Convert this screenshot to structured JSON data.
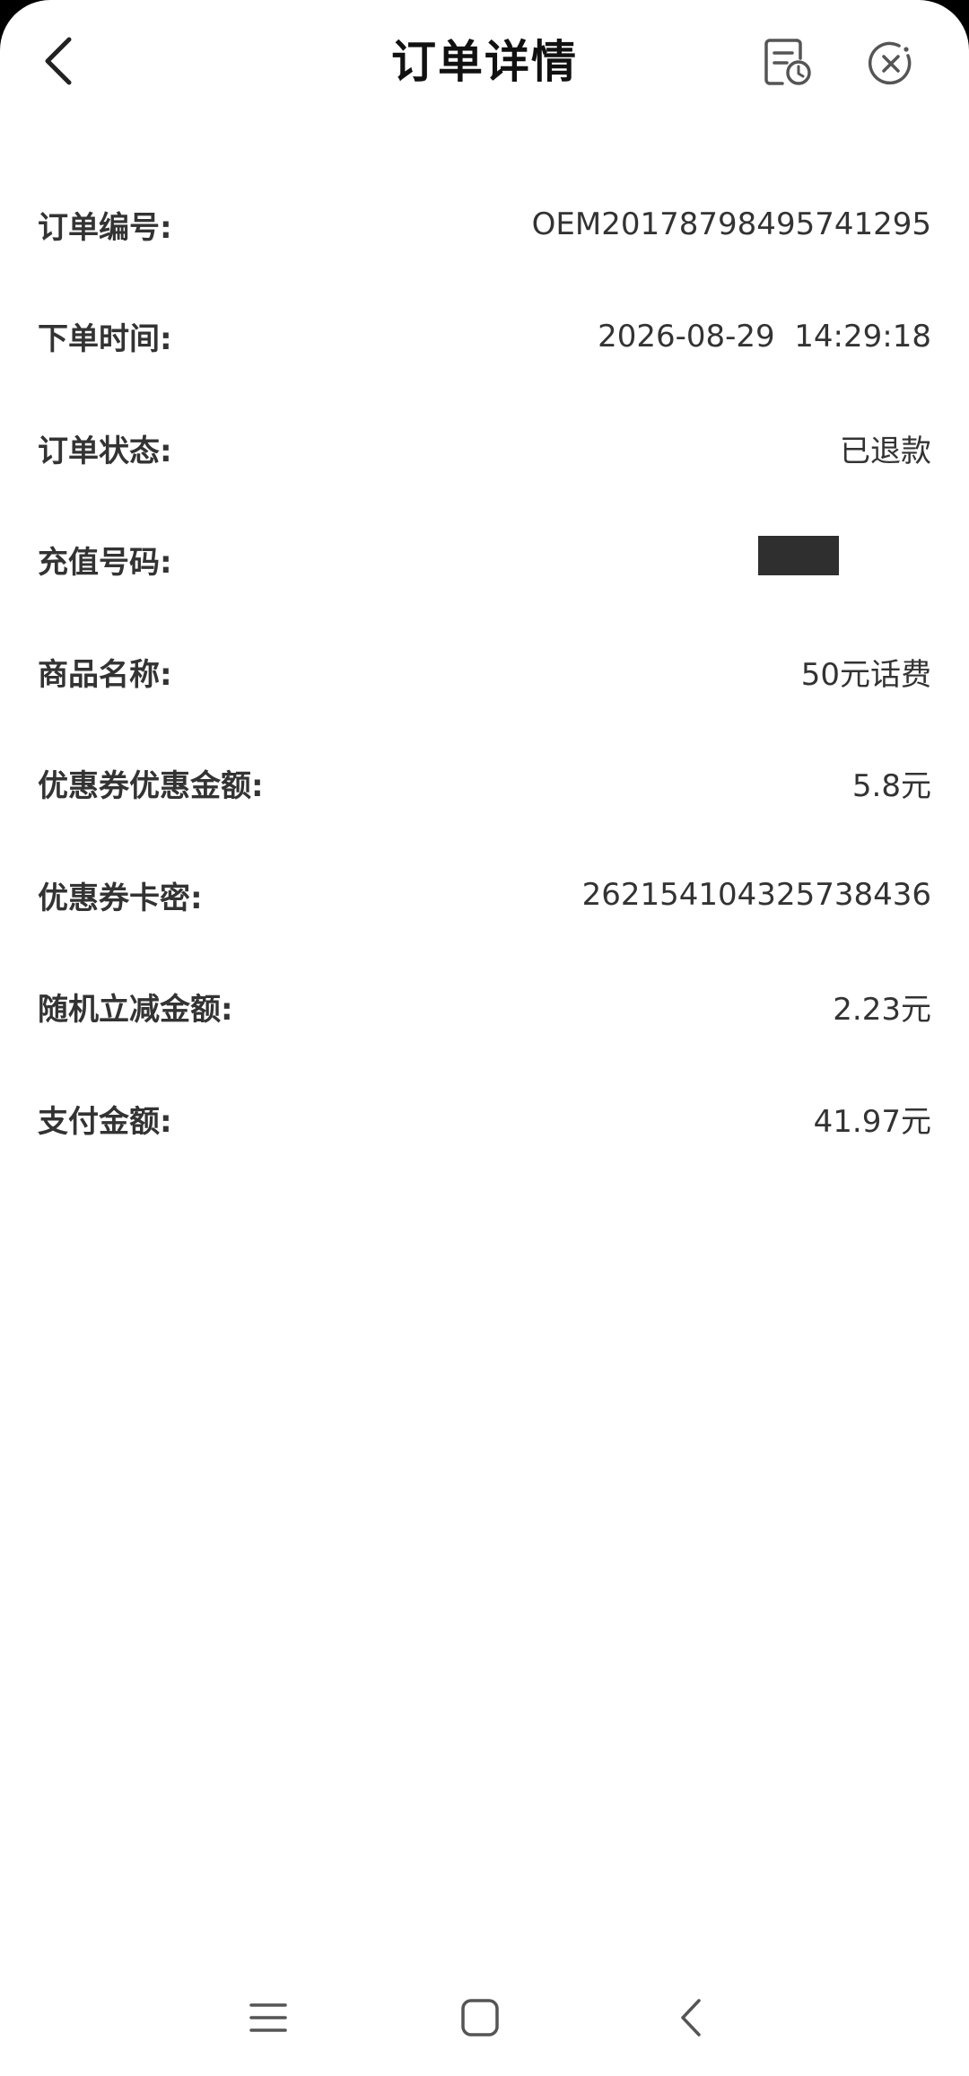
{
  "header": {
    "title": "订单详情"
  },
  "details": {
    "rows": [
      {
        "label": "订单编号:",
        "value": "OEM20178798495741295"
      },
      {
        "label": "下单时间:",
        "value": "2026-08-29  14:29:18"
      },
      {
        "label": "订单状态:",
        "value": "已退款"
      },
      {
        "label": "充值号码:",
        "value": ""
      },
      {
        "label": "商品名称:",
        "value": "50元话费"
      },
      {
        "label": "优惠券优惠金额:",
        "value": "5.8元"
      },
      {
        "label": "优惠券卡密:",
        "value": "262154104325738436"
      },
      {
        "label": "随机立减金额:",
        "value": "2.23元"
      },
      {
        "label": "支付金额:",
        "value": "41.97元"
      }
    ]
  },
  "icons": {
    "back": "chevron-left-icon",
    "order_history": "document-clock-icon",
    "close": "circle-close-icon",
    "nav_menu": "menu-lines-icon",
    "nav_home": "rounded-square-icon",
    "nav_back": "chevron-left-icon"
  },
  "colors": {
    "text_primary": "#111111",
    "text_body": "#333333",
    "mask": "#2f2f2f",
    "icon_gray": "#555555"
  }
}
